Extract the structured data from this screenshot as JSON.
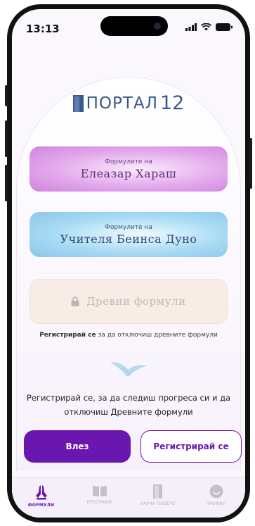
{
  "status_bar": {
    "time": "13:13"
  },
  "logo": {
    "text": "ПОРТАЛ",
    "number": "12"
  },
  "cards": [
    {
      "subtitle": "Формулите на",
      "title": "Елеазар Хараш"
    },
    {
      "subtitle": "Формулите на",
      "title": "Учителя Беинса Дуно"
    },
    {
      "title": "Древни формули",
      "icon": "lock-icon"
    }
  ],
  "hint": {
    "bold": "Регистрирай се",
    "rest": " за да отключиш древните формули"
  },
  "promo_text": "Регистрирай се, за да следиш прогреса си и да отключиш Древните формули",
  "buttons": {
    "login": "Влез",
    "register": "Регистрирай се"
  },
  "tabs": [
    {
      "label": "ФОРМУЛИ",
      "icon": "praying-hands-icon",
      "active": true
    },
    {
      "label": "ПРОГРАМИ",
      "icon": "book-icon",
      "active": false
    },
    {
      "label": "НАУЧИ ПОВЕЧЕ",
      "icon": "door-icon",
      "active": false
    },
    {
      "label": "ПРОФИЛ",
      "icon": "smiley-icon",
      "active": false
    }
  ],
  "colors": {
    "accent": "#6a17b0",
    "logo_blue": "#3b5a8a"
  }
}
